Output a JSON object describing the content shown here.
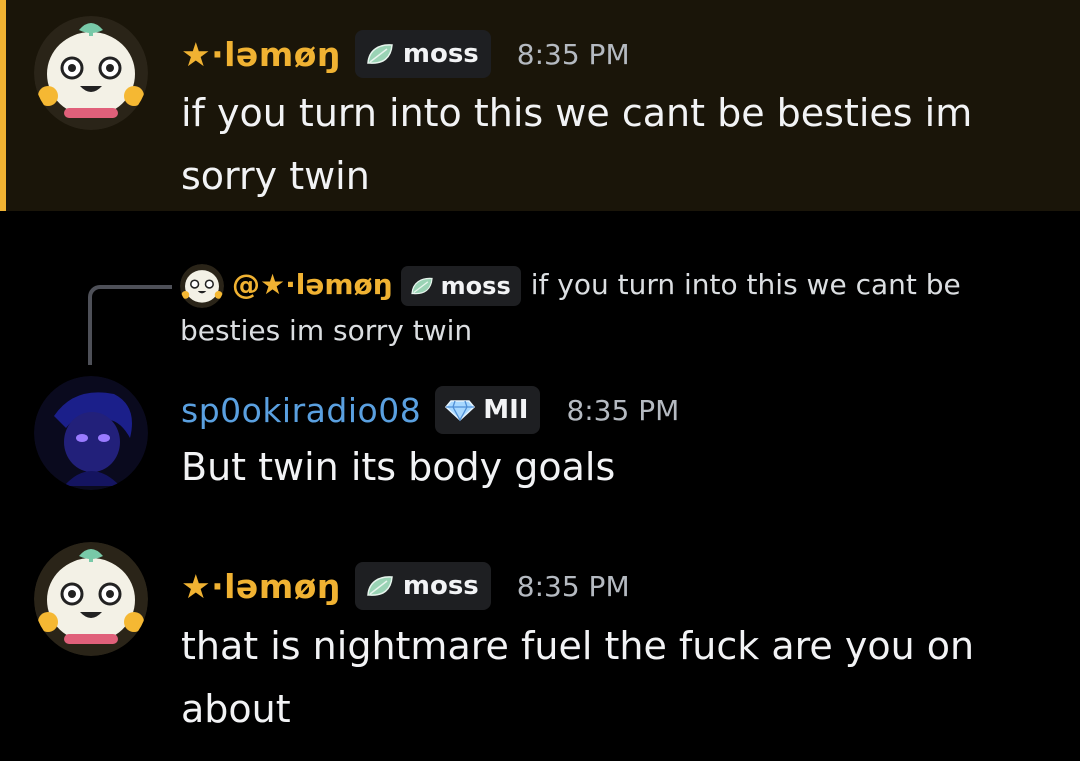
{
  "colors": {
    "lemon_name": "#f0b232",
    "spooki_name": "#5aa0e0",
    "highlight_bar": "#f0b232",
    "highlight_bg": "#1a1509"
  },
  "messages": [
    {
      "username": "★·ləmøŋ",
      "tag_icon": "leaf-icon",
      "tag": "moss",
      "timestamp": "8:35 PM",
      "text": "if you turn into this we cant be besties im sorry twin"
    },
    {
      "reply": {
        "mention": "@★·ləmøŋ",
        "tag_icon": "leaf-icon",
        "tag": "moss",
        "text": "if you turn into this we cant be besties im sorry twin"
      },
      "username": "sp0okiradio08",
      "tag_icon": "gem-icon",
      "tag": "MII",
      "timestamp": "8:35 PM",
      "text": "But twin its body goals"
    },
    {
      "username": "★·ləmøŋ",
      "tag_icon": "leaf-icon",
      "tag": "moss",
      "timestamp": "8:35 PM",
      "text": "that is nightmare fuel the fuck are you on about"
    }
  ]
}
